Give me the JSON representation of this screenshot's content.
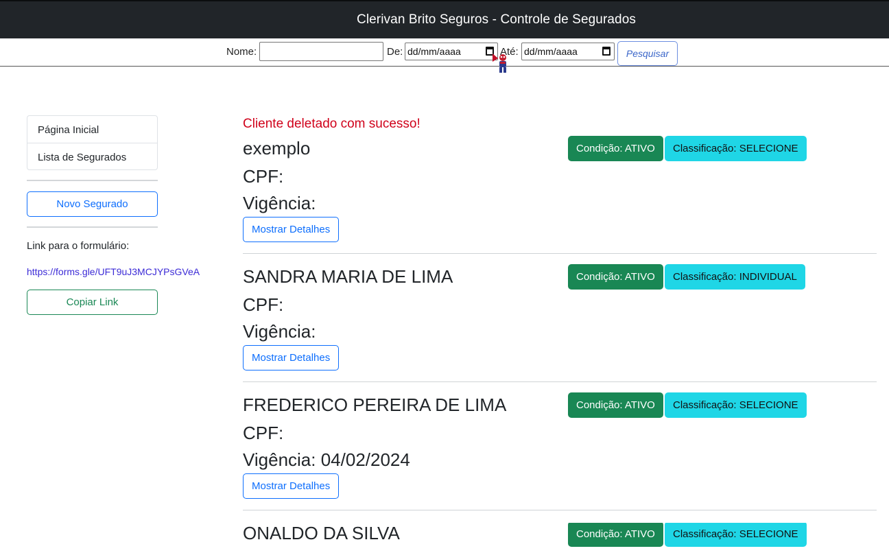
{
  "header": {
    "title": "Clerivan Brito Seguros - Controle de Segurados"
  },
  "filter": {
    "name_label": "Nome:",
    "name_value": "",
    "from_label": "De:",
    "from_value": "dd/mm/aaaa",
    "to_label": "Até:",
    "to_value": "dd/mm/aaaa",
    "search_label": "Pesquisar"
  },
  "sidebar": {
    "items": [
      {
        "label": "Página Inicial"
      },
      {
        "label": "Lista de Segurados"
      }
    ],
    "new_button": "Novo Segurado",
    "form_link_label": "Link para o formulário:",
    "form_link_url": "https://forms.gle/UFT9uJ3MCJYPsGVeA",
    "copy_button": "Copiar Link"
  },
  "alert": "Cliente deletado com sucesso!",
  "clients": [
    {
      "name": "exemplo",
      "cpf_label": "CPF:",
      "vigencia_label": "Vigência:",
      "condicao": "Condição: ATIVO",
      "classificacao": "Classificação: SELECIONE",
      "details_label": "Mostrar Detalhes"
    },
    {
      "name": "SANDRA MARIA DE LIMA",
      "cpf_label": "CPF:",
      "vigencia_label": "Vigência:",
      "condicao": "Condição: ATIVO",
      "classificacao": "Classificação: INDIVIDUAL",
      "details_label": "Mostrar Detalhes"
    },
    {
      "name": "FREDERICO PEREIRA DE LIMA",
      "cpf_label": "CPF:",
      "vigencia_label": "Vigência: 04/02/2024",
      "condicao": "Condição: ATIVO",
      "classificacao": "Classificação: SELECIONE",
      "details_label": "Mostrar Detalhes"
    },
    {
      "name": "ONALDO DA SILVA",
      "condicao": "Condição: ATIVO",
      "classificacao": "Classificação: SELECIONE"
    }
  ],
  "colors": {
    "navbar": "#212529",
    "primary": "#0d6efd",
    "success": "#198754",
    "info": "#1fd6e6",
    "alert": "#d0021b"
  }
}
